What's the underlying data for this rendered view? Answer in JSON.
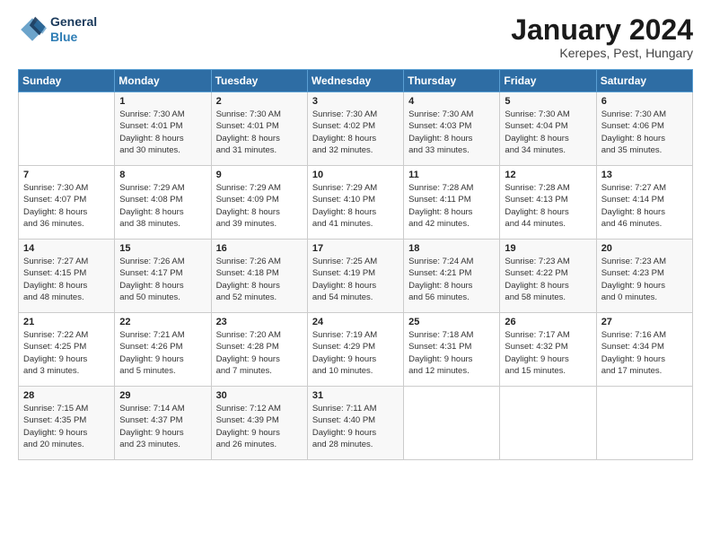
{
  "header": {
    "logo_line1": "General",
    "logo_line2": "Blue",
    "title": "January 2024",
    "subtitle": "Kerepes, Pest, Hungary"
  },
  "days_of_week": [
    "Sunday",
    "Monday",
    "Tuesday",
    "Wednesday",
    "Thursday",
    "Friday",
    "Saturday"
  ],
  "weeks": [
    [
      {
        "day": "",
        "info": ""
      },
      {
        "day": "1",
        "info": "Sunrise: 7:30 AM\nSunset: 4:01 PM\nDaylight: 8 hours\nand 30 minutes."
      },
      {
        "day": "2",
        "info": "Sunrise: 7:30 AM\nSunset: 4:01 PM\nDaylight: 8 hours\nand 31 minutes."
      },
      {
        "day": "3",
        "info": "Sunrise: 7:30 AM\nSunset: 4:02 PM\nDaylight: 8 hours\nand 32 minutes."
      },
      {
        "day": "4",
        "info": "Sunrise: 7:30 AM\nSunset: 4:03 PM\nDaylight: 8 hours\nand 33 minutes."
      },
      {
        "day": "5",
        "info": "Sunrise: 7:30 AM\nSunset: 4:04 PM\nDaylight: 8 hours\nand 34 minutes."
      },
      {
        "day": "6",
        "info": "Sunrise: 7:30 AM\nSunset: 4:06 PM\nDaylight: 8 hours\nand 35 minutes."
      }
    ],
    [
      {
        "day": "7",
        "info": "Sunrise: 7:30 AM\nSunset: 4:07 PM\nDaylight: 8 hours\nand 36 minutes."
      },
      {
        "day": "8",
        "info": "Sunrise: 7:29 AM\nSunset: 4:08 PM\nDaylight: 8 hours\nand 38 minutes."
      },
      {
        "day": "9",
        "info": "Sunrise: 7:29 AM\nSunset: 4:09 PM\nDaylight: 8 hours\nand 39 minutes."
      },
      {
        "day": "10",
        "info": "Sunrise: 7:29 AM\nSunset: 4:10 PM\nDaylight: 8 hours\nand 41 minutes."
      },
      {
        "day": "11",
        "info": "Sunrise: 7:28 AM\nSunset: 4:11 PM\nDaylight: 8 hours\nand 42 minutes."
      },
      {
        "day": "12",
        "info": "Sunrise: 7:28 AM\nSunset: 4:13 PM\nDaylight: 8 hours\nand 44 minutes."
      },
      {
        "day": "13",
        "info": "Sunrise: 7:27 AM\nSunset: 4:14 PM\nDaylight: 8 hours\nand 46 minutes."
      }
    ],
    [
      {
        "day": "14",
        "info": "Sunrise: 7:27 AM\nSunset: 4:15 PM\nDaylight: 8 hours\nand 48 minutes."
      },
      {
        "day": "15",
        "info": "Sunrise: 7:26 AM\nSunset: 4:17 PM\nDaylight: 8 hours\nand 50 minutes."
      },
      {
        "day": "16",
        "info": "Sunrise: 7:26 AM\nSunset: 4:18 PM\nDaylight: 8 hours\nand 52 minutes."
      },
      {
        "day": "17",
        "info": "Sunrise: 7:25 AM\nSunset: 4:19 PM\nDaylight: 8 hours\nand 54 minutes."
      },
      {
        "day": "18",
        "info": "Sunrise: 7:24 AM\nSunset: 4:21 PM\nDaylight: 8 hours\nand 56 minutes."
      },
      {
        "day": "19",
        "info": "Sunrise: 7:23 AM\nSunset: 4:22 PM\nDaylight: 8 hours\nand 58 minutes."
      },
      {
        "day": "20",
        "info": "Sunrise: 7:23 AM\nSunset: 4:23 PM\nDaylight: 9 hours\nand 0 minutes."
      }
    ],
    [
      {
        "day": "21",
        "info": "Sunrise: 7:22 AM\nSunset: 4:25 PM\nDaylight: 9 hours\nand 3 minutes."
      },
      {
        "day": "22",
        "info": "Sunrise: 7:21 AM\nSunset: 4:26 PM\nDaylight: 9 hours\nand 5 minutes."
      },
      {
        "day": "23",
        "info": "Sunrise: 7:20 AM\nSunset: 4:28 PM\nDaylight: 9 hours\nand 7 minutes."
      },
      {
        "day": "24",
        "info": "Sunrise: 7:19 AM\nSunset: 4:29 PM\nDaylight: 9 hours\nand 10 minutes."
      },
      {
        "day": "25",
        "info": "Sunrise: 7:18 AM\nSunset: 4:31 PM\nDaylight: 9 hours\nand 12 minutes."
      },
      {
        "day": "26",
        "info": "Sunrise: 7:17 AM\nSunset: 4:32 PM\nDaylight: 9 hours\nand 15 minutes."
      },
      {
        "day": "27",
        "info": "Sunrise: 7:16 AM\nSunset: 4:34 PM\nDaylight: 9 hours\nand 17 minutes."
      }
    ],
    [
      {
        "day": "28",
        "info": "Sunrise: 7:15 AM\nSunset: 4:35 PM\nDaylight: 9 hours\nand 20 minutes."
      },
      {
        "day": "29",
        "info": "Sunrise: 7:14 AM\nSunset: 4:37 PM\nDaylight: 9 hours\nand 23 minutes."
      },
      {
        "day": "30",
        "info": "Sunrise: 7:12 AM\nSunset: 4:39 PM\nDaylight: 9 hours\nand 26 minutes."
      },
      {
        "day": "31",
        "info": "Sunrise: 7:11 AM\nSunset: 4:40 PM\nDaylight: 9 hours\nand 28 minutes."
      },
      {
        "day": "",
        "info": ""
      },
      {
        "day": "",
        "info": ""
      },
      {
        "day": "",
        "info": ""
      }
    ]
  ]
}
